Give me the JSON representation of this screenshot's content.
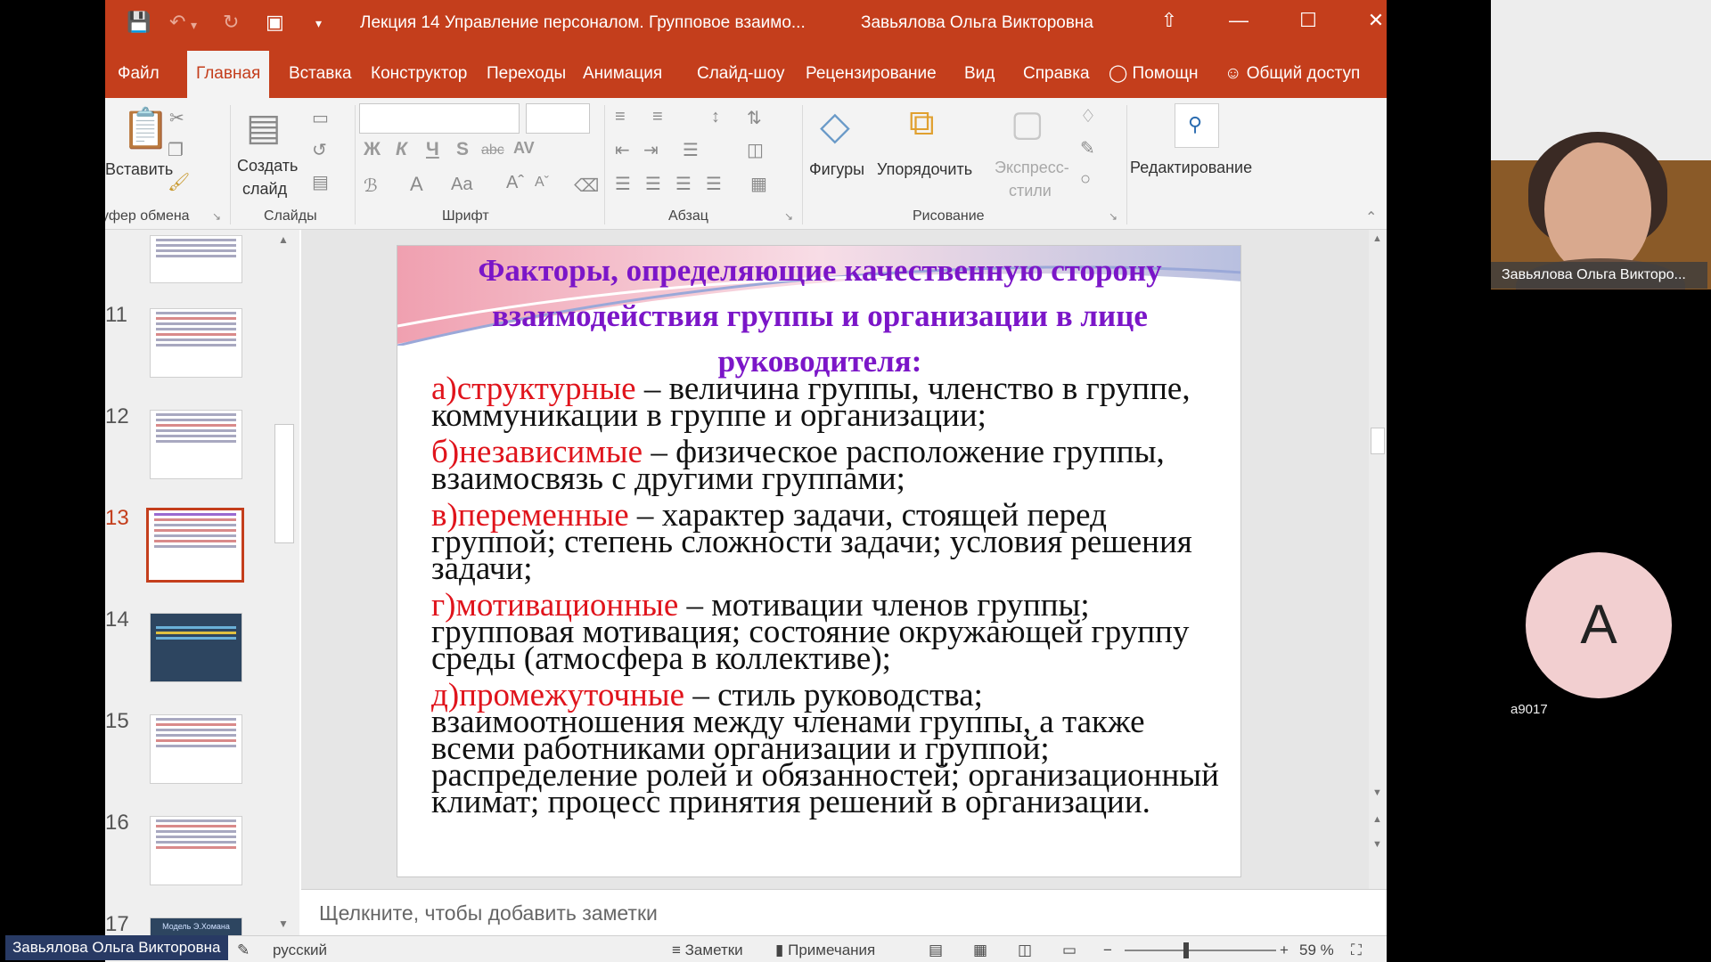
{
  "window": {
    "doc_title": "Лекция 14 Управление персоналом. Групповое взаимо...",
    "user_name": "Завьялова Ольга Викторовна",
    "accent_color": "#c43e1c"
  },
  "tabs": [
    "Файл",
    "Главная",
    "Вставка",
    "Конструктор",
    "Переходы",
    "Анимация",
    "Слайд-шоу",
    "Рецензирование",
    "Вид",
    "Справка",
    "Помощн",
    "Общий доступ"
  ],
  "active_tab": "Главная",
  "ribbon": {
    "paste": "Вставить",
    "new_slide_1": "Создать",
    "new_slide_2": "слайд",
    "groups": {
      "clipboard": "уфер обмена",
      "slides": "Слайды",
      "font": "Шрифт",
      "paragraph": "Абзац",
      "drawing": "Рисование"
    },
    "shapes": "Фигуры",
    "arrange": "Упорядочить",
    "quick_styles_1": "Экспресс-",
    "quick_styles_2": "стили",
    "editing": "Редактирование",
    "font_buttons": [
      "Ж",
      "К",
      "Ч",
      "S",
      "abc",
      "AV"
    ]
  },
  "thumbnails": {
    "numbers": [
      "11",
      "12",
      "13",
      "14",
      "15",
      "16",
      "17"
    ],
    "selected": "13",
    "last_title": "Модель Э.Хомана"
  },
  "slide": {
    "title": "Факторы, определяющие качественную сторону взаимодействия группы и организации в лице руководителя:",
    "items": [
      {
        "key": "а)структурные",
        "text": " – величина группы, членство в группе, коммуникации в группе и организации;"
      },
      {
        "key": "б)независимые",
        "text": " – физическое расположение группы, взаимосвязь с другими группами;"
      },
      {
        "key": "в)переменные",
        "text": " – характер задачи, стоящей перед группой; степень сложности задачи; условия решения задачи;"
      },
      {
        "key": "г)мотивационные",
        "text": " – мотивации членов группы; групповая мотивация; состояние окружающей группу среды (атмосфера в коллективе);"
      },
      {
        "key": "д)промежуточные",
        "text": " – стиль руководства; взаимоотношения между членами группы, а также всеми работниками организации и группой; распределение ролей и обязанностей; организационный климат; процесс принятия решений в организации."
      }
    ],
    "title_color": "#7b16c8",
    "key_color": "#e0141c"
  },
  "notes_placeholder": "Щелкните, чтобы добавить заметки",
  "status": {
    "language": "русский",
    "notes": "Заметки",
    "comments": "Примечания",
    "zoom": "59 %"
  },
  "meeting": {
    "video_name": "Завьялова Ольга Викторо...",
    "avatar_letter": "A",
    "avatar_label": "a9017",
    "presenter_tag": "Завьялова Ольга Викторовна"
  }
}
